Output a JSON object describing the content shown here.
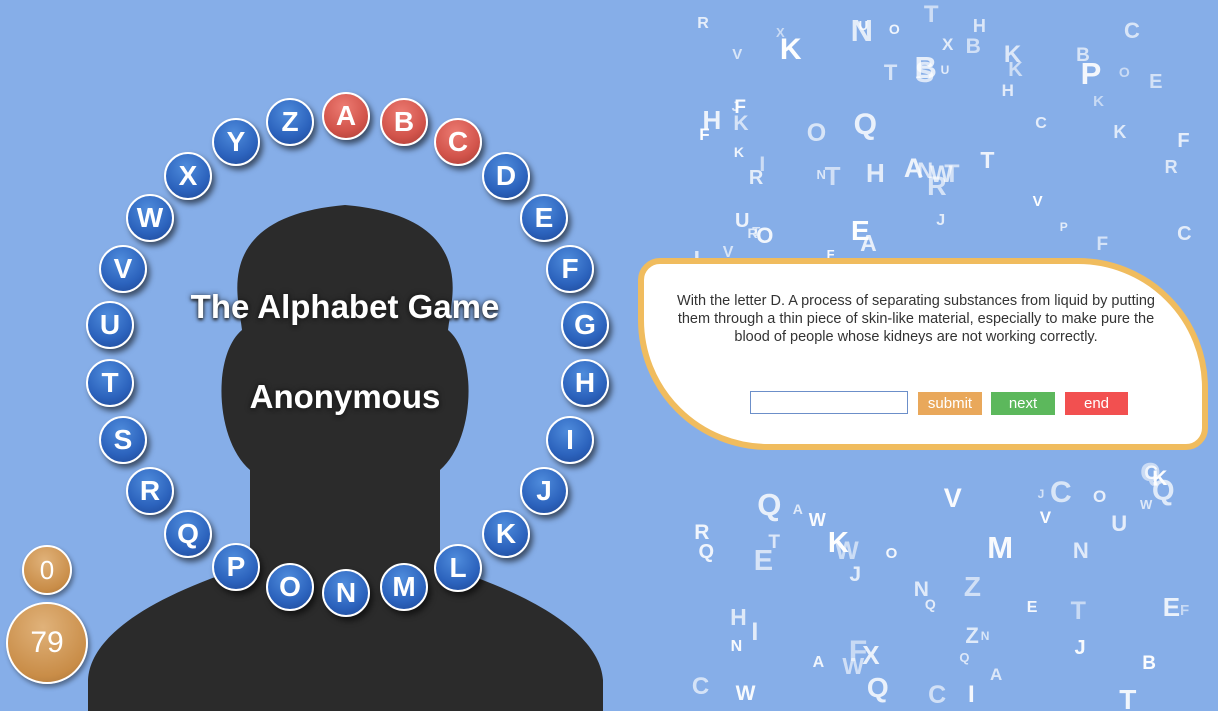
{
  "title": "The Alphabet Game",
  "player_name": "Anonymous",
  "alphabet": [
    {
      "letter": "A",
      "state": "answered"
    },
    {
      "letter": "B",
      "state": "answered"
    },
    {
      "letter": "C",
      "state": "answered"
    },
    {
      "letter": "D",
      "state": "pending"
    },
    {
      "letter": "E",
      "state": "pending"
    },
    {
      "letter": "F",
      "state": "pending"
    },
    {
      "letter": "G",
      "state": "pending"
    },
    {
      "letter": "H",
      "state": "pending"
    },
    {
      "letter": "I",
      "state": "pending"
    },
    {
      "letter": "J",
      "state": "pending"
    },
    {
      "letter": "K",
      "state": "pending"
    },
    {
      "letter": "L",
      "state": "pending"
    },
    {
      "letter": "M",
      "state": "pending"
    },
    {
      "letter": "N",
      "state": "pending"
    },
    {
      "letter": "O",
      "state": "pending"
    },
    {
      "letter": "P",
      "state": "pending"
    },
    {
      "letter": "Q",
      "state": "pending"
    },
    {
      "letter": "R",
      "state": "pending"
    },
    {
      "letter": "S",
      "state": "pending"
    },
    {
      "letter": "T",
      "state": "pending"
    },
    {
      "letter": "U",
      "state": "pending"
    },
    {
      "letter": "V",
      "state": "pending"
    },
    {
      "letter": "W",
      "state": "pending"
    },
    {
      "letter": "X",
      "state": "pending"
    },
    {
      "letter": "Y",
      "state": "pending"
    },
    {
      "letter": "Z",
      "state": "pending"
    }
  ],
  "scores": {
    "small": "0",
    "big": "79"
  },
  "question": {
    "text": "With the letter D. A process of separating substances from liquid by putting them through a thin piece of skin-like material, especially to make pure the blood of people whose kidneys are not working correctly.",
    "answer_value": "",
    "submit_label": "submit",
    "next_label": "next",
    "end_label": "end"
  },
  "colors": {
    "background": "#86aee8",
    "letter_pending": "#2c63bd",
    "letter_answered": "#d2544b",
    "silhouette": "#2b2b2b",
    "card_border": "#f0bc5e",
    "submit": "#e9a85b",
    "next": "#5cb85c",
    "end": "#f25050"
  },
  "background_letters": "RHWTKFVNTNWICNTKEHVIWEHEXZXVKKRXFVZIKVIBNWCCNWKKUEOCHBKAQOQAUFJSNQBJTUTUFTNKWJTQJRJCRQAABPQPRQOTCAOTFRHCQOMOFFE"
}
